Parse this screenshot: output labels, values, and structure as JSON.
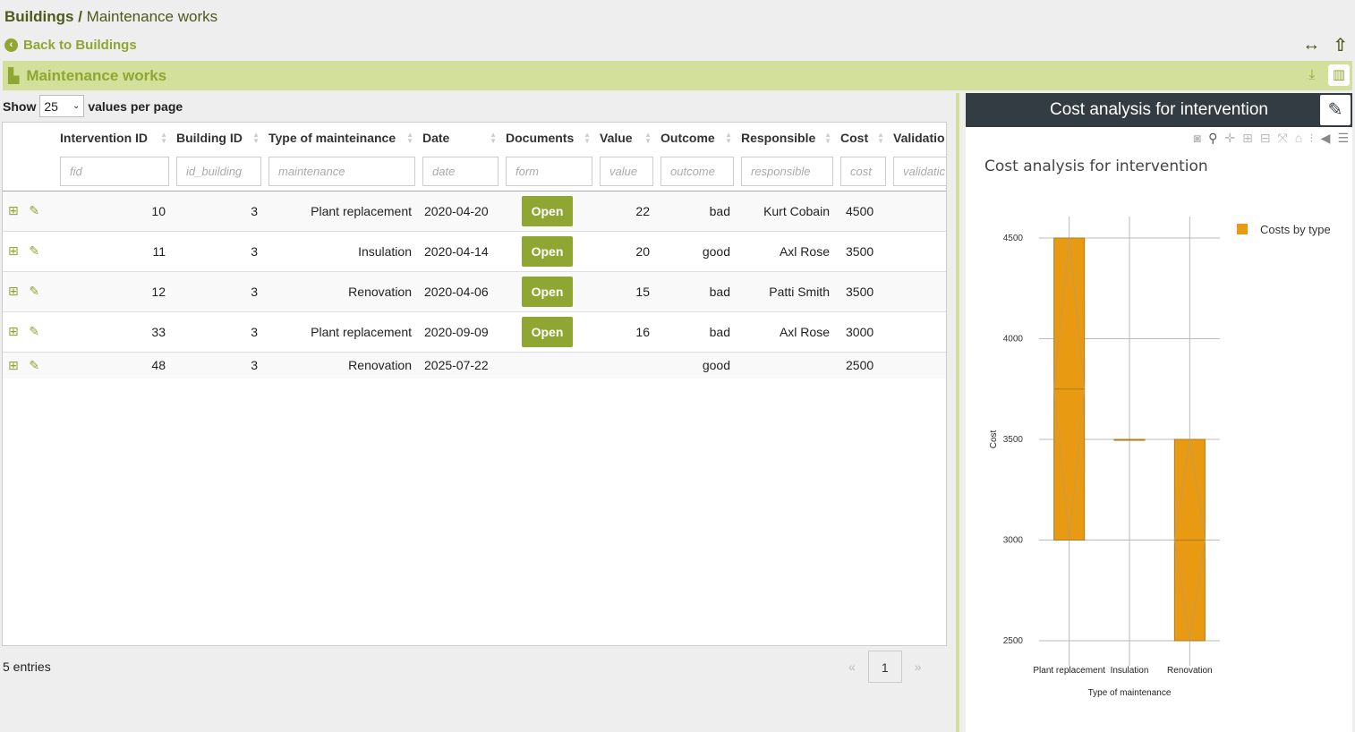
{
  "breadcrumb": {
    "parent": "Buildings",
    "separator": "/",
    "current": "Maintenance works"
  },
  "back_link": "Back to Buildings",
  "section": {
    "title": "Maintenance works"
  },
  "pagination": {
    "show_label": "Show",
    "page_size": "25",
    "per_page_label": "values per page",
    "entries": "5 entries",
    "current_page": "1",
    "prev": "«",
    "next": "»"
  },
  "table": {
    "columns": [
      "Intervention ID",
      "Building ID",
      "Type of mainteinance",
      "Date",
      "Documents",
      "Value",
      "Outcome",
      "Responsible",
      "Cost",
      "Validatio"
    ],
    "filters": [
      "fid",
      "id_building",
      "maintenance",
      "date",
      "form",
      "value",
      "outcome",
      "responsible",
      "cost",
      "validatic"
    ],
    "open_label": "Open",
    "rows": [
      {
        "id": "10",
        "building": "3",
        "type": "Plant replacement",
        "date": "2020-04-20",
        "has_doc": true,
        "value": "22",
        "outcome": "bad",
        "responsible": "Kurt Cobain",
        "cost": "4500"
      },
      {
        "id": "11",
        "building": "3",
        "type": "Insulation",
        "date": "2020-04-14",
        "has_doc": true,
        "value": "20",
        "outcome": "good",
        "responsible": "Axl Rose",
        "cost": "3500"
      },
      {
        "id": "12",
        "building": "3",
        "type": "Renovation",
        "date": "2020-04-06",
        "has_doc": true,
        "value": "15",
        "outcome": "bad",
        "responsible": "Patti Smith",
        "cost": "3500"
      },
      {
        "id": "33",
        "building": "3",
        "type": "Plant replacement",
        "date": "2020-09-09",
        "has_doc": true,
        "value": "16",
        "outcome": "bad",
        "responsible": "Axl Rose",
        "cost": "3000"
      },
      {
        "id": "48",
        "building": "3",
        "type": "Renovation",
        "date": "2025-07-22",
        "has_doc": false,
        "value": "",
        "outcome": "good",
        "responsible": "",
        "cost": "2500"
      }
    ]
  },
  "panel": {
    "header": "Cost analysis for intervention"
  },
  "colors": {
    "accent": "#8fa632",
    "dark": "#333c42",
    "bar": "#e89a12"
  },
  "chart_data": {
    "type": "box",
    "title": "Cost analysis for intervention",
    "xlabel": "Type of maintenance",
    "ylabel": "Cost",
    "categories": [
      "Plant replacement",
      "Insulation",
      "Renovation"
    ],
    "series": [
      {
        "name": "Costs by type",
        "boxes": [
          {
            "min": 3000,
            "median": 3750,
            "max": 4500
          },
          {
            "min": 3500,
            "median": 3500,
            "max": 3500
          },
          {
            "min": 2500,
            "median": 3000,
            "max": 3500
          }
        ]
      }
    ],
    "yticks": [
      2500,
      3000,
      3500,
      4000,
      4500
    ],
    "ylim": [
      2500,
      4500
    ],
    "legend_position": "top-right"
  }
}
